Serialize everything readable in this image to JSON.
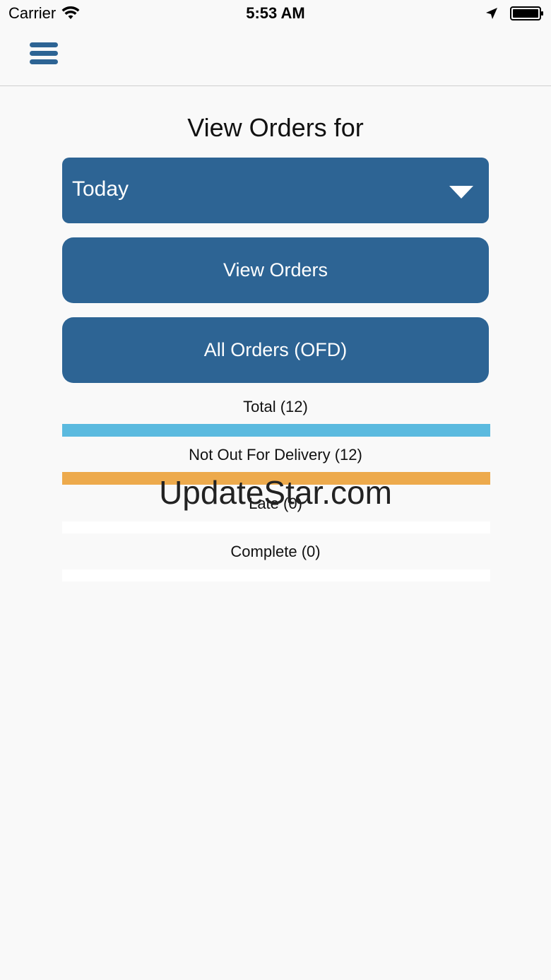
{
  "status_bar": {
    "carrier": "Carrier",
    "time": "5:53 AM",
    "icons": [
      "wifi-icon",
      "location-icon",
      "battery-icon"
    ]
  },
  "nav": {
    "menu_icon": "hamburger-menu-icon"
  },
  "page": {
    "title": "View Orders for"
  },
  "date_dropdown": {
    "selected": "Today"
  },
  "buttons": {
    "view_orders": "View Orders",
    "all_orders": "All Orders (OFD)"
  },
  "stats": [
    {
      "label": "Total (12)",
      "color": "#5bbadf"
    },
    {
      "label": "Not Out For Delivery (12)",
      "color": "#edaa4c"
    },
    {
      "label": "Late (0)",
      "color": "#ffffff"
    },
    {
      "label": "Complete (0)",
      "color": "#ffffff"
    }
  ],
  "watermark": "UpdateStar.com",
  "colors": {
    "primary": "#2d6494",
    "background": "#f9f9f9"
  }
}
